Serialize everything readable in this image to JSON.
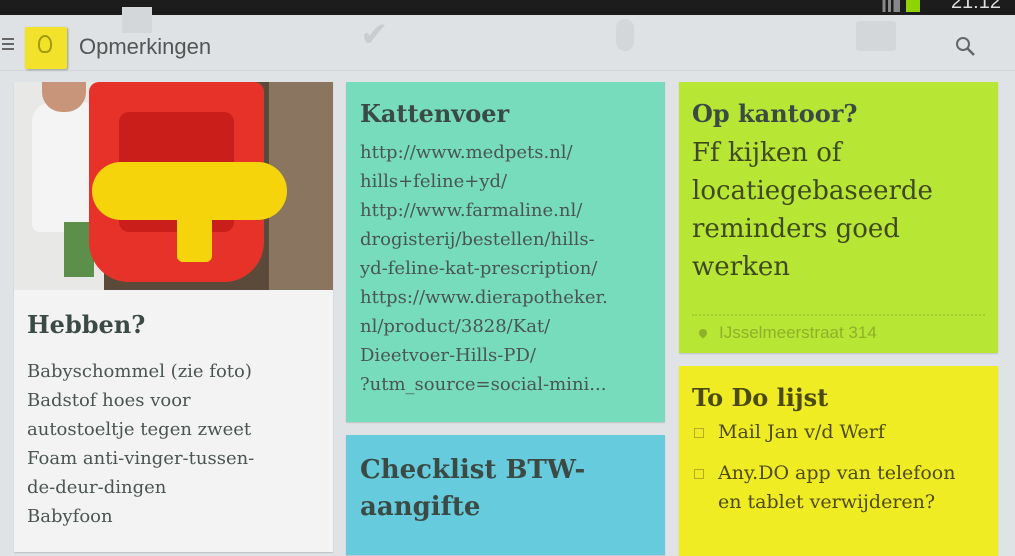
{
  "status": {
    "time": "21:12"
  },
  "appbar": {
    "title": "Opmerkingen",
    "logo_icon": "keep-lightbulb-icon",
    "menu_icon": "menu-icon",
    "search_icon": "search-icon"
  },
  "notes": [
    {
      "title": "Hebben?",
      "color": "#f3f3f3",
      "has_image": true,
      "lines": [
        "Babyschommel (zie foto)",
        "Badstof hoes voor",
        "autostoeltje tegen zweet",
        "Foam anti-vinger-tussen-",
        "de-deur-dingen",
        "Babyfoon"
      ]
    },
    {
      "title": "Kattenvoer",
      "color": "#76dcbb",
      "lines": [
        "http://www.medpets.nl/",
        "hills+feline+yd/",
        "http://www.farmaline.nl/",
        "drogisterij/bestellen/hills-",
        "yd-feline-kat-prescription/",
        "https://www.dierapotheker.",
        "nl/product/3828/Kat/",
        "Dieetvoer-Hills-PD/",
        "?utm_source=social-mini..."
      ]
    },
    {
      "title": "Checklist BTW-aangifte",
      "color": "#66cbdc"
    },
    {
      "title": "Op kantoor?",
      "color": "#b8e635",
      "lines": [
        "Ff kijken of",
        "locatiegebaseerde",
        "reminders goed",
        "werken"
      ],
      "location": "IJsselmeerstraat 314"
    },
    {
      "title": "To Do lijst",
      "color": "#f0ec23",
      "items": [
        {
          "text": "Mail Jan v/d Werf",
          "checked": false
        },
        {
          "text": "Any.DO app van telefoon en tablet verwijderen?",
          "checked": false
        }
      ]
    }
  ]
}
